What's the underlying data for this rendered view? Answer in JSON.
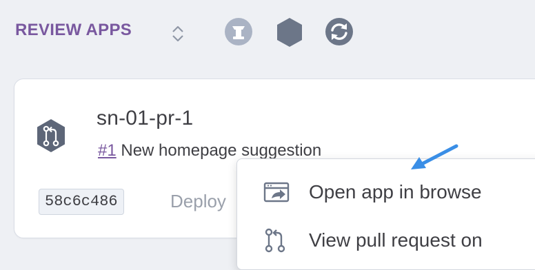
{
  "header": {
    "title": "REVIEW APPS",
    "icons": [
      "sort-icon",
      "review-badge-icon",
      "hexagon-icon",
      "sync-icon"
    ]
  },
  "app": {
    "name": "sn-01-pr-1",
    "pr_number": "#1",
    "pr_title": "New homepage suggestion",
    "commit": "58c6c486",
    "deploy_text": "Deploy"
  },
  "menu": {
    "items": [
      {
        "label": "Open app in browse",
        "icon": "open-in-browser-icon"
      },
      {
        "label": "View pull request on",
        "icon": "pull-request-icon"
      }
    ]
  },
  "colors": {
    "accent": "#79589f",
    "icon_muted": "#aab3c4",
    "icon_dark": "#6c7688",
    "arrow": "#3a8ee6"
  }
}
